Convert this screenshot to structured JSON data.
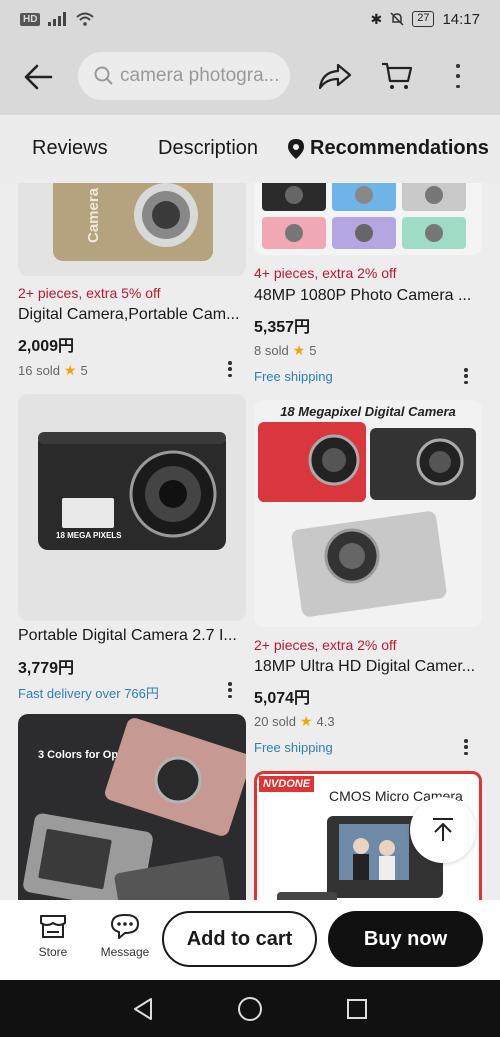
{
  "status_bar": {
    "network": "HD",
    "battery": "27",
    "time": "14:17"
  },
  "search": {
    "placeholder": "camera photogra..."
  },
  "tabs": [
    {
      "label": "Reviews"
    },
    {
      "label": "Description"
    },
    {
      "label": "Recommendations"
    }
  ],
  "products": [
    {
      "promo": "2+ pieces, extra 5% off",
      "title": "Digital Camera,Portable Cam...",
      "price": "2,009円",
      "sold": "16 sold",
      "rating": "5",
      "image_label": "Camera"
    },
    {
      "promo": "4+ pieces, extra 2% off",
      "title": "48MP 1080P Photo Camera ...",
      "price": "5,357円",
      "sold": "8 sold",
      "rating": "5",
      "shipping": "Free shipping"
    },
    {
      "title": "Portable Digital Camera 2.7 I...",
      "price": "3,779円",
      "delivery": "Fast delivery over 766円",
      "image_label": "18 MEGA PIXELS"
    },
    {
      "image_caption": "18 Megapixel Digital Camera",
      "promo": "2+ pieces, extra 2% off",
      "title": "18MP Ultra HD Digital Camer...",
      "price": "5,074円",
      "sold": "20 sold",
      "rating": "4.3",
      "shipping": "Free shipping"
    },
    {
      "image_caption": "3 Colors for Option"
    },
    {
      "brand": "NVDONE",
      "image_caption": "CMOS Micro Camera"
    }
  ],
  "bottom_bar": {
    "store_label": "Store",
    "message_label": "Message",
    "add_to_cart": "Add to cart",
    "buy_now": "Buy now"
  },
  "colors": {
    "promo": "#c0182e",
    "link": "#2d7fb8",
    "star": "#f0a500",
    "buy_now_bg": "#111111"
  }
}
